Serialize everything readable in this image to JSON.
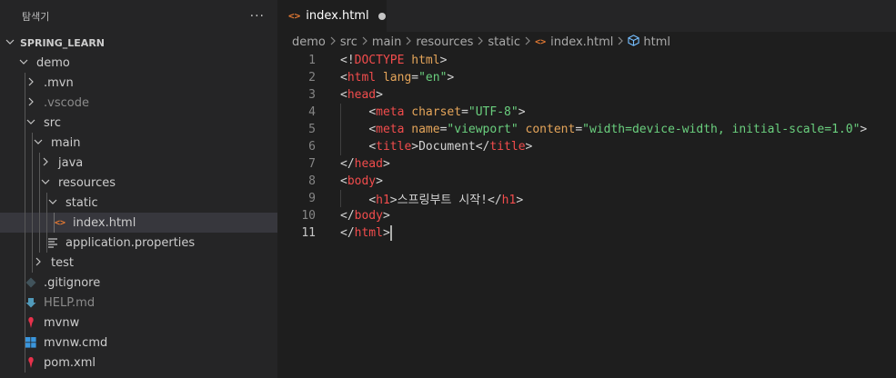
{
  "sidebar": {
    "title": "탐색기",
    "more": "···",
    "section": "SPRING_LEARN",
    "items": [
      {
        "label": "demo",
        "indent": 1,
        "chev": "v",
        "icon": "",
        "dim": false
      },
      {
        "label": ".mvn",
        "indent": 2,
        "chev": ">",
        "icon": "",
        "dim": false
      },
      {
        "label": ".vscode",
        "indent": 2,
        "chev": ">",
        "icon": "",
        "dim": true
      },
      {
        "label": "src",
        "indent": 2,
        "chev": "v",
        "icon": "",
        "dim": false
      },
      {
        "label": "main",
        "indent": 3,
        "chev": "v",
        "icon": "",
        "dim": false
      },
      {
        "label": "java",
        "indent": 4,
        "chev": ">",
        "icon": "",
        "dim": false
      },
      {
        "label": "resources",
        "indent": 4,
        "chev": "v",
        "icon": "",
        "dim": false
      },
      {
        "label": "static",
        "indent": 5,
        "chev": "v",
        "icon": "",
        "dim": false
      },
      {
        "label": "index.html",
        "indent": 6,
        "chev": "",
        "icon": "html",
        "dim": false,
        "active": true
      },
      {
        "label": "application.properties",
        "indent": 5,
        "chev": "",
        "icon": "props",
        "dim": false
      },
      {
        "label": "test",
        "indent": 3,
        "chev": ">",
        "icon": "",
        "dim": false
      },
      {
        "label": ".gitignore",
        "indent": 2,
        "chev": "",
        "icon": "git",
        "dim": false
      },
      {
        "label": "HELP.md",
        "indent": 2,
        "chev": "",
        "icon": "md",
        "dim": true
      },
      {
        "label": "mvnw",
        "indent": 2,
        "chev": "",
        "icon": "mvn",
        "dim": false
      },
      {
        "label": "mvnw.cmd",
        "indent": 2,
        "chev": "",
        "icon": "win",
        "dim": false
      },
      {
        "label": "pom.xml",
        "indent": 2,
        "chev": "",
        "icon": "mvn",
        "dim": false
      }
    ]
  },
  "tab": {
    "label": "index.html",
    "icon_text": "<>"
  },
  "breadcrumb": [
    "demo",
    "src",
    "main",
    "resources",
    "static",
    "index.html",
    "html"
  ],
  "icon_text": {
    "html": "<>"
  },
  "code": {
    "lines": [
      "1",
      "2",
      "3",
      "4",
      "5",
      "6",
      "7",
      "8",
      "9",
      "10",
      "11"
    ],
    "current_line": 11
  },
  "colors": {
    "tag": "#f14c4c",
    "attr": "#e5a55a",
    "value": "#6acf7e",
    "html_icon": "#e37933",
    "sidebar_bg": "#252526",
    "editor_bg": "#1e1e1e"
  }
}
